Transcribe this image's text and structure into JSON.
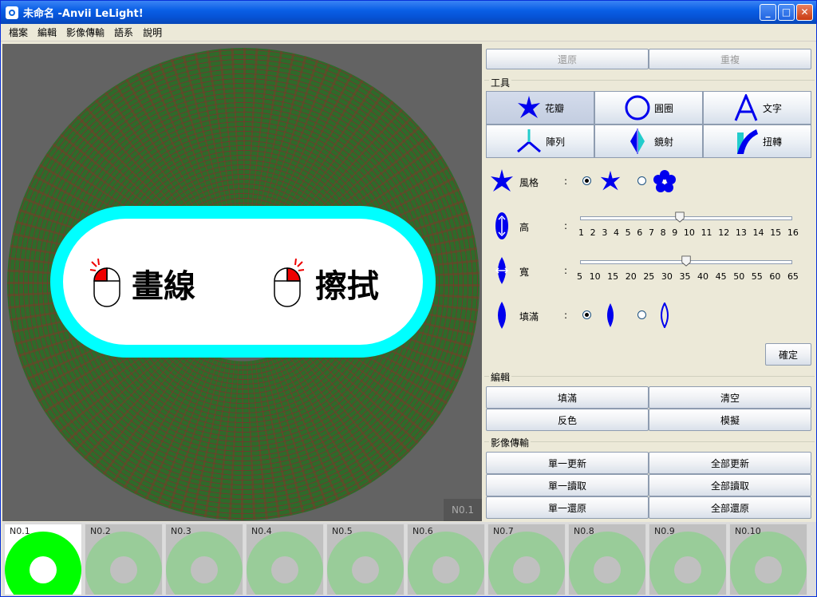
{
  "window": {
    "title": "未命名 -Anvii LeLight!",
    "minimize": "_",
    "maximize": "□",
    "close": "✕"
  },
  "menu": [
    "檔案",
    "編輯",
    "影像傳輸",
    "語系",
    "說明"
  ],
  "canvas": {
    "page_tag": "N0.1",
    "hint_draw": "畫線",
    "hint_erase": "擦拭",
    "disc_color": "#2f6a2a"
  },
  "panel": {
    "undo": "還原",
    "redo": "重複",
    "tools_title": "工具",
    "tools": [
      {
        "label": "花瓣",
        "icon": "petal-icon"
      },
      {
        "label": "圓圈",
        "icon": "circle-icon"
      },
      {
        "label": "文字",
        "icon": "text-icon"
      },
      {
        "label": "陣列",
        "icon": "array-icon"
      },
      {
        "label": "鏡射",
        "icon": "mirror-icon"
      },
      {
        "label": "扭轉",
        "icon": "twist-icon"
      }
    ],
    "style_label": "風格",
    "height_label": "高",
    "width_label": "寬",
    "fill_label": "填滿",
    "colon": ":",
    "height_ticks": [
      "1",
      "2",
      "3",
      "4",
      "5",
      "6",
      "7",
      "8",
      "9",
      "10",
      "11",
      "12",
      "13",
      "14",
      "15",
      "16"
    ],
    "height_value": 8,
    "width_ticks": [
      "5",
      "10",
      "15",
      "20",
      "25",
      "30",
      "35",
      "40",
      "45",
      "50",
      "55",
      "60",
      "65"
    ],
    "width_value": 35,
    "confirm": "確定",
    "edit_title": "編輯",
    "edit_buttons": [
      "填滿",
      "清空",
      "反色",
      "模擬"
    ],
    "transfer_title": "影像傳輸",
    "transfer_buttons": [
      "單一更新",
      "全部更新",
      "單一讀取",
      "全部讀取",
      "單一還原",
      "全部還原"
    ]
  },
  "pages": [
    "N0.1",
    "N0.2",
    "N0.3",
    "N0.4",
    "N0.5",
    "N0.6",
    "N0.7",
    "N0.8",
    "N0.9",
    "N0.10"
  ],
  "colors": {
    "active_page": "#00ff00",
    "inactive_page": "#99cc99",
    "accent_blue": "#0000ee",
    "cyan": "#00ffff"
  }
}
